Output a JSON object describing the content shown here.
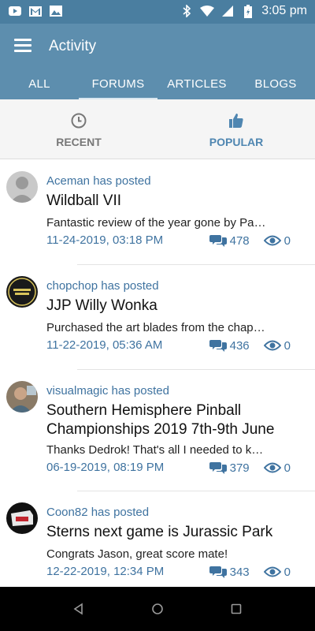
{
  "status_bar": {
    "time": "3:05 pm",
    "left_icons": [
      "youtube-icon",
      "gmail-icon",
      "image-icon"
    ],
    "right_icons": [
      "bluetooth-icon",
      "wifi-icon",
      "signal-icon",
      "battery-icon"
    ]
  },
  "app_bar": {
    "title": "Activity"
  },
  "tabs": [
    {
      "label": "ALL"
    },
    {
      "label": "FORUMS",
      "active": true
    },
    {
      "label": "ARTICLES"
    },
    {
      "label": "BLOGS"
    }
  ],
  "subtabs": {
    "recent": {
      "label": "RECENT",
      "icon": "clock-icon"
    },
    "popular": {
      "label": "POPULAR",
      "icon": "thumbs-up-icon",
      "active": true
    }
  },
  "posts": [
    {
      "author": "Aceman has posted",
      "title": "Wildball VII",
      "excerpt": "Fantastic review of the year gone by Pa…",
      "date": "11-24-2019, 03:18 PM",
      "replies": "478",
      "views": "0"
    },
    {
      "author": "chopchop has posted",
      "title": "JJP Willy Wonka",
      "excerpt": "Purchased the art blades from the chap…",
      "date": "11-22-2019, 05:36 AM",
      "replies": "436",
      "views": "0"
    },
    {
      "author": "visualmagic has posted",
      "title": "Southern Hemisphere Pinball Championships 2019 7th-9th June",
      "excerpt": "Thanks Dedrok! That's all I needed to k…",
      "date": "06-19-2019, 08:19 PM",
      "replies": "379",
      "views": "0"
    },
    {
      "author": "Coon82 has posted",
      "title": "Sterns next game is Jurassic Park",
      "excerpt": "Congrats Jason, great score mate!",
      "date": "12-22-2019, 12:34 PM",
      "replies": "343",
      "views": "0"
    }
  ],
  "colors": {
    "status_bar": "#4a7ea0",
    "app_bar": "#5d8eae",
    "accent": "#3f73a0"
  }
}
